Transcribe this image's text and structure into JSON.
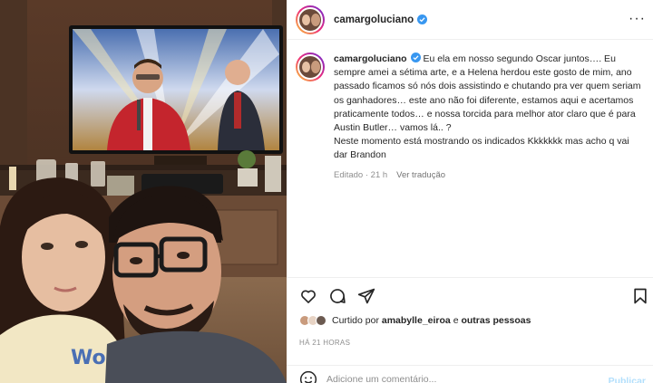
{
  "post": {
    "username": "camargoluciano",
    "caption_username": "camargoluciano",
    "caption": "Eu ela em nosso segundo Oscar juntos…. Eu sempre amei a sétima arte, e a Helena herdou este gosto de mim, ano passado ficamos só nós dois assistindo e chutando pra ver quem seriam os ganhadores… este ano não foi diferente, estamos aqui e acertamos praticamente todos… e nossa torcida para melhor ator claro que é para Austin Butler… vamos lá.. ?\nNeste momento está mostrando os indicados Kkkkkkk mas acho q vai dar Brandon",
    "edited_label": "Editado · 21 h",
    "translate_label": "Ver tradução"
  },
  "likes": {
    "prefix": "Curtido por",
    "user": "amabylle_eiroa",
    "joiner": "e",
    "others": "outras pessoas"
  },
  "time_ago": "HÁ 21 HORAS",
  "comment_box": {
    "placeholder": "Adicione um comentário...",
    "publish_label": "Publicar"
  },
  "colors": {
    "verified": "#3897f0",
    "publish_disabled": "#b2dffc",
    "border": "#efefef",
    "secondary_text": "#8e8e8e"
  },
  "icons": [
    "more-options-icon",
    "heart-icon",
    "comment-icon",
    "share-icon",
    "bookmark-icon",
    "emoji-icon",
    "verified-badge-icon"
  ]
}
